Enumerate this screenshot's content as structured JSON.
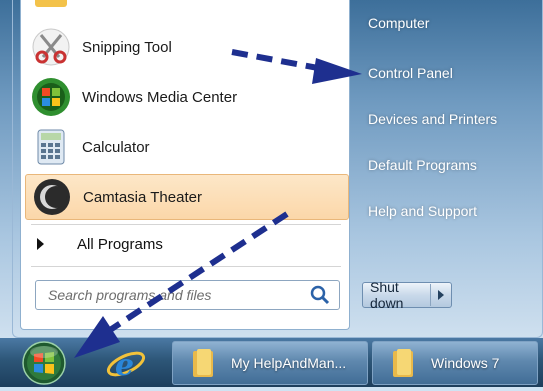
{
  "start_menu": {
    "programs": [
      {
        "label": "",
        "icon": "partial-program-icon"
      },
      {
        "label": "Snipping Tool",
        "icon": "scissors-icon"
      },
      {
        "label": "Windows Media Center",
        "icon": "media-center-icon"
      },
      {
        "label": "Calculator",
        "icon": "calculator-icon"
      },
      {
        "label": "Camtasia Theater",
        "icon": "camtasia-icon",
        "highlighted": true
      }
    ],
    "all_programs_label": "All Programs",
    "search": {
      "placeholder": "Search programs and files"
    },
    "right_links": [
      "Computer",
      "Control Panel",
      "Devices and Printers",
      "Default Programs",
      "Help and Support"
    ],
    "shutdown_label": "Shut down"
  },
  "taskbar": {
    "buttons": [
      "My HelpAndMan...",
      "Windows 7"
    ]
  },
  "colors": {
    "annotation_arrow": "#1e2f8f",
    "highlight": "#fbd7a9"
  }
}
